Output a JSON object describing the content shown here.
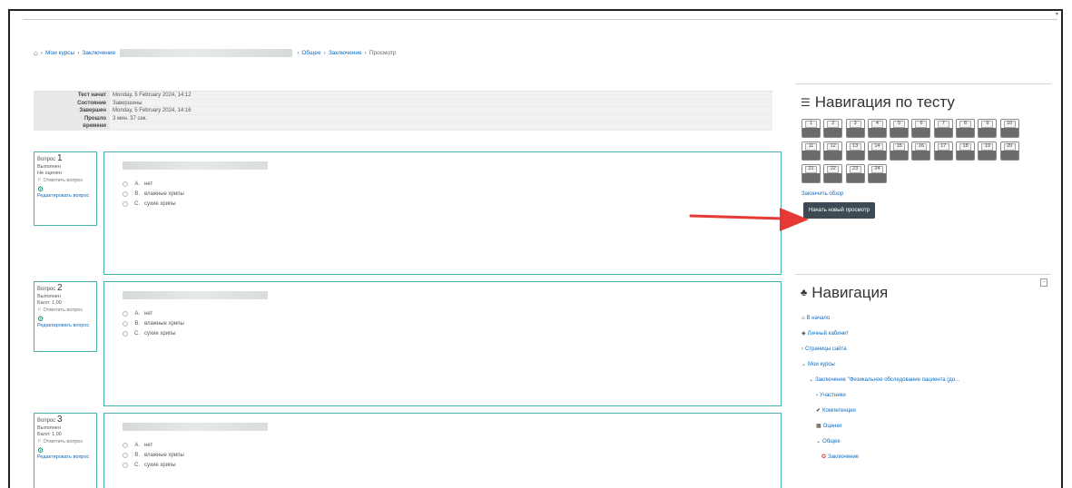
{
  "breadcrumb": {
    "home_icon": "home-icon",
    "items": [
      "Мои курсы",
      "Заключение",
      "Общее",
      "Заключение",
      "Просмотр"
    ]
  },
  "summary": [
    {
      "label": "Тест начат",
      "value": "Monday, 5 February 2024, 14:12"
    },
    {
      "label": "Состояние",
      "value": "Завершены"
    },
    {
      "label": "Завершен",
      "value": "Monday, 5 February 2024, 14:16"
    },
    {
      "label": "Прошло",
      "value": "3 мин. 37 сек."
    },
    {
      "label": "времени",
      "value": ""
    }
  ],
  "questions": [
    {
      "label": "Вопрос",
      "number": "1",
      "status": "Выполнен",
      "grade": "Не оценен",
      "flag": "Отметить вопрос",
      "edit": "Редактировать вопрос",
      "answers": [
        {
          "letter": "A.",
          "text": "нет"
        },
        {
          "letter": "B.",
          "text": "влажные хрипы"
        },
        {
          "letter": "C.",
          "text": "сухие хрипы"
        }
      ]
    },
    {
      "label": "Вопрос",
      "number": "2",
      "status": "Выполнен",
      "grade": "Балл: 1,00",
      "flag": "Отметить вопрос",
      "edit": "Редактировать вопрос",
      "answers": [
        {
          "letter": "A.",
          "text": "нет"
        },
        {
          "letter": "B.",
          "text": "влажные хрипы"
        },
        {
          "letter": "C.",
          "text": "сухие хрипы"
        }
      ]
    },
    {
      "label": "Вопрос",
      "number": "3",
      "status": "Выполнен",
      "grade": "Балл: 1,00",
      "flag": "Отметить вопрос",
      "edit": "Редактировать вопрос",
      "answers": [
        {
          "letter": "A.",
          "text": "нет"
        },
        {
          "letter": "B.",
          "text": "влажные хрипы"
        },
        {
          "letter": "C.",
          "text": "сухие хрипы"
        }
      ]
    }
  ],
  "quiz_nav": {
    "title": "Навигация по тесту",
    "buttons": [
      "1",
      "2",
      "3",
      "4",
      "5",
      "6",
      "7",
      "8",
      "9",
      "10",
      "11",
      "12",
      "13",
      "14",
      "15",
      "16",
      "17",
      "18",
      "19",
      "20",
      "21",
      "22",
      "23",
      "24"
    ],
    "finish_link": "Закончить обзор",
    "new_attempt": "Начать новый просмотр"
  },
  "navigation": {
    "title": "Навигация",
    "items": [
      {
        "text": "В начало",
        "icon": "home-icon"
      },
      {
        "text": "Личный кабинет",
        "icon": "dashboard-icon"
      },
      {
        "text": "Страницы сайта",
        "icon": "chevron-right-icon"
      },
      {
        "text": "Мои курсы",
        "icon": "chevron-down-icon"
      },
      {
        "text": "Заключение \"Физикальное обследование пациента (до...",
        "icon": "chevron-down-icon"
      },
      {
        "text": "Участники",
        "icon": "chevron-right-icon"
      },
      {
        "text": "Компетенции",
        "icon": "check-icon"
      },
      {
        "text": "Оценки",
        "icon": "grades-icon"
      },
      {
        "text": "Общее",
        "icon": "chevron-down-icon"
      },
      {
        "text": "Заключение",
        "icon": "quiz-icon"
      }
    ]
  },
  "colors": {
    "accent_border": "#4ab2a6",
    "link": "#0f6cbf",
    "arrow": "#e53935",
    "nav_fill": "#6b6b6b"
  }
}
